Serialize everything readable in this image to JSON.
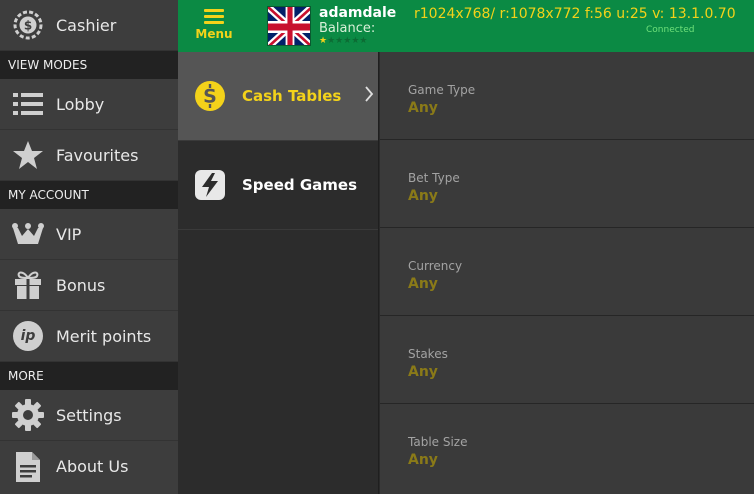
{
  "sidemenu": {
    "cashier": "Cashier",
    "section_view_modes": "VIEW MODES",
    "lobby": "Lobby",
    "favourites": "Favourites",
    "section_my_account": "MY ACCOUNT",
    "vip": "VIP",
    "bonus": "Bonus",
    "merit_points": "Merit points",
    "merit_icon_text": "ip",
    "section_more": "MORE",
    "settings": "Settings",
    "about_us": "About Us"
  },
  "header": {
    "menu_label": "Menu",
    "username": "adamdale",
    "balance_label": "Balance:",
    "vip_level": 1,
    "vip_max": 6,
    "debug_text": "r1024x768/ r:1078x772 f:56 u:25 v: 13.1.0.70",
    "connection_status": "Connected",
    "flag": "uk-flag"
  },
  "categories": [
    {
      "label": "Cash Tables",
      "icon": "dollar-coin-icon",
      "active": true
    },
    {
      "label": "Speed Games",
      "icon": "lightning-icon",
      "active": false
    }
  ],
  "filters": [
    {
      "label": "Game Type",
      "value": "Any"
    },
    {
      "label": "Bet Type",
      "value": "Any"
    },
    {
      "label": "Currency",
      "value": "Any"
    },
    {
      "label": "Stakes",
      "value": "Any"
    },
    {
      "label": "Table Size",
      "value": "Any"
    }
  ],
  "colors": {
    "header_green": "#0b8a44",
    "accent_yellow": "#f3d21a",
    "filter_value_gold": "#8a7a18"
  }
}
